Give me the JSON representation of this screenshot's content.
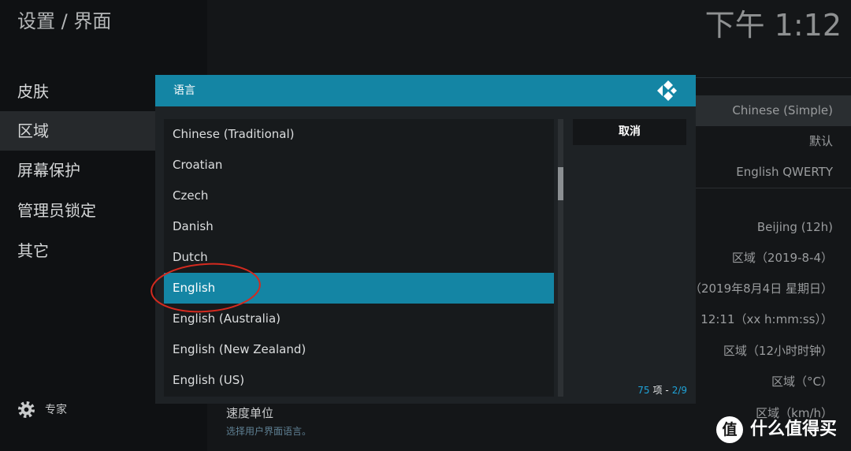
{
  "header": {
    "title": "设置 / 界面",
    "clock": "下午 1:12"
  },
  "sidebar": {
    "selected_index": 1,
    "items": [
      {
        "label": "皮肤"
      },
      {
        "label": "区域"
      },
      {
        "label": "屏幕保护"
      },
      {
        "label": "管理员锁定"
      },
      {
        "label": "其它"
      }
    ],
    "level": {
      "icon": "gear-icon",
      "label": "专家"
    }
  },
  "settings": {
    "focused_index": 0,
    "rows": [
      {
        "value": "Chinese (Simple)"
      },
      {
        "value": "默认"
      },
      {
        "value": "English QWERTY"
      },
      {
        "value": "Beijing (12h)"
      },
      {
        "value": "区域（2019-8-4）"
      },
      {
        "value": "（2019年8月4日 星期日）"
      },
      {
        "value": "12:11（xx h:mm:ss））"
      },
      {
        "value": "区域（12小时时钟）"
      },
      {
        "value": "区域（°C）"
      },
      {
        "label": "速度单位",
        "value": "区域（km/h）"
      }
    ],
    "description": "选择用户界面语言。"
  },
  "dialog": {
    "title": "语言",
    "logo_icon": "kodi-logo-icon",
    "selected_index": 5,
    "items": [
      {
        "label": "Chinese (Traditional)"
      },
      {
        "label": "Croatian"
      },
      {
        "label": "Czech"
      },
      {
        "label": "Danish"
      },
      {
        "label": "Dutch"
      },
      {
        "label": "English"
      },
      {
        "label": "English (Australia)"
      },
      {
        "label": "English (New Zealand)"
      },
      {
        "label": "English (US)"
      }
    ],
    "cancel_label": "取消",
    "item_count": "75",
    "item_count_suffix": "项 -",
    "page": "2/9"
  },
  "watermark": {
    "badge": "值",
    "text": "什么值得买"
  },
  "colors": {
    "accent": "#1485a4",
    "counter": "#1fa3d8",
    "annotation": "#d42a1f"
  }
}
